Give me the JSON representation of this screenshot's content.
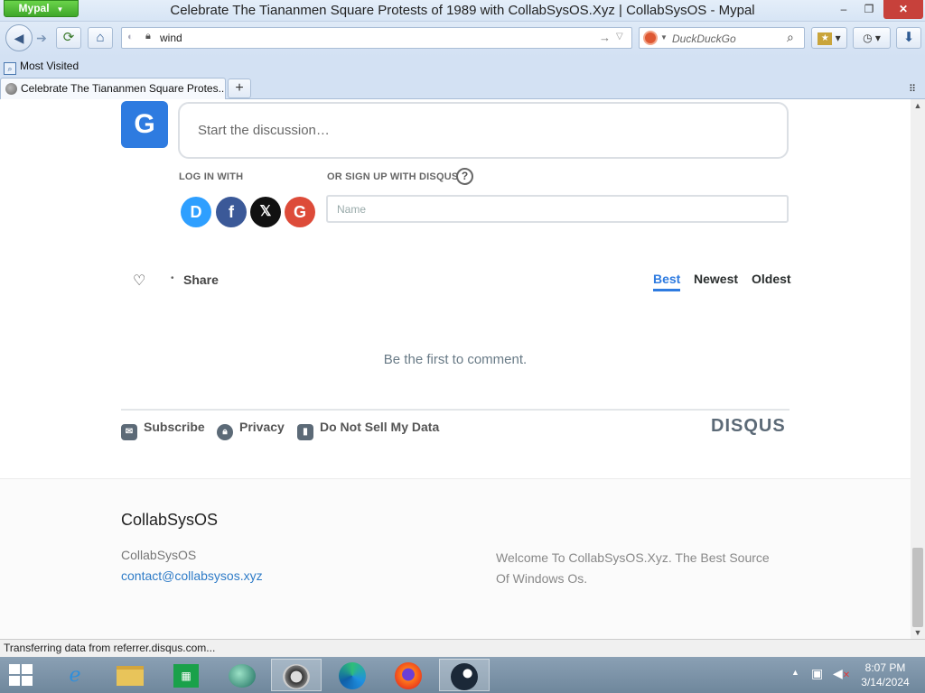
{
  "window": {
    "app_menu": "Mypal",
    "title": "Celebrate The Tiananmen Square Protests of 1989 with CollabSysOS.Xyz | CollabSysOS - Mypal",
    "minimize": "–",
    "maximize": "❐",
    "close": "✕"
  },
  "navbar": {
    "url": "wind",
    "search_placeholder": "DuckDuckGo"
  },
  "bookmarks": {
    "items": [
      {
        "label": "Most Visited"
      }
    ]
  },
  "tabs": [
    {
      "label": "Celebrate The Tiananmen Square Protes..."
    }
  ],
  "comments": {
    "avatar_letter": "G",
    "placeholder": "Start the discussion…",
    "login_label": "LOG IN WITH",
    "signup_label": "OR SIGN UP WITH DISQUS",
    "help": "?",
    "social": [
      "D",
      "f",
      "𝕏",
      "G"
    ],
    "name_placeholder": "Name",
    "share": "Share",
    "sort_tabs": [
      "Best",
      "Newest",
      "Oldest"
    ],
    "active_sort": "Best",
    "empty_message": "Be the first to comment.",
    "footer_links": [
      "Subscribe",
      "Privacy",
      "Do Not Sell My Data"
    ],
    "brand": "DISQUS"
  },
  "site_footer": {
    "title": "CollabSysOS",
    "name": "CollabSysOS",
    "email": "contact@collabsysos.xyz",
    "description": "Welcome To CollabSysOS.Xyz. The Best Source Of Windows Os."
  },
  "status": "Transferring data from referrer.disqus.com...",
  "taskbar": {
    "apps": [
      "internet-explorer",
      "file-explorer",
      "store",
      "orb-app",
      "mypal",
      "edge",
      "firefox",
      "steam"
    ],
    "time": "8:07 PM",
    "date": "3/14/2024"
  },
  "colors": {
    "disqus_blue": "#2e7be0",
    "link": "#2e7bc7",
    "close_red": "#c7413b"
  }
}
